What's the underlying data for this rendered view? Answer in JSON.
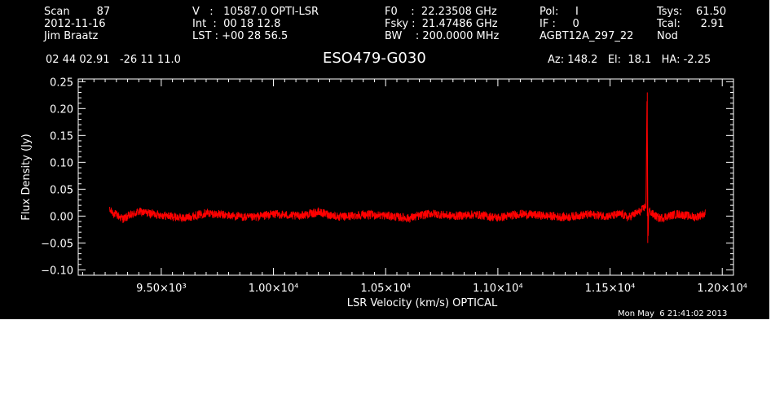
{
  "header": {
    "col1": [
      "Scan        87",
      "2012-11-16",
      "Jim Braatz"
    ],
    "col2": [
      "V   :   10587.0 OPTI-LSR",
      "Int  :  00 18 12.8",
      "LST : +00 28 56.5"
    ],
    "col3": [
      "F0    :  22.23508 GHz",
      "Fsky :  21.47486 GHz",
      "BW    : 200.0000 MHz"
    ],
    "col4": [
      "Pol:     I",
      "IF :     0",
      "AGBT12A_297_22"
    ],
    "col5": [
      "Tsys:    61.50",
      "Tcal:      2.91",
      "Nod"
    ]
  },
  "coords": "02 44 02.91   -26 11 11.0",
  "source": "ESO479-G030",
  "azelha": "Az: 148.2   El:  18.1   HA: -2.25",
  "timestamp": "Mon May  6 21:41:02 2013",
  "colors": {
    "background": "#000000",
    "axes": "#ffffff",
    "trace": "#ff0000"
  },
  "chart_data": {
    "type": "line",
    "title": "ESO479-G030",
    "xlabel": "LSR Velocity (km/s) OPTICAL",
    "ylabel": "Flux Density (Jy)",
    "xlim": [
      9130,
      12050
    ],
    "ylim": [
      -0.11,
      0.255
    ],
    "xticks": [
      9500,
      10000,
      10500,
      11000,
      11500,
      12000
    ],
    "xtick_labels": [
      "9.50×10³",
      "1.00×10⁴",
      "1.05×10⁴",
      "1.10×10⁴",
      "1.15×10⁴",
      "1.20×10⁴"
    ],
    "yticks": [
      -0.1,
      -0.05,
      0.0,
      0.05,
      0.1,
      0.15,
      0.2,
      0.25
    ],
    "ytick_labels": [
      "−0.10",
      "−0.05",
      "0.00",
      "0.05",
      "0.10",
      "0.15",
      "0.20",
      "0.25"
    ],
    "series": [
      {
        "x": [
          9270,
          9330,
          9400,
          9500,
          9600,
          9700,
          9800,
          9900,
          10000,
          10100,
          10200,
          10300,
          10400,
          10500,
          10600,
          10700,
          10800,
          10900,
          11000,
          11100,
          11200,
          11300,
          11400,
          11500,
          11550,
          11580,
          11600,
          11640,
          11660,
          11665,
          11667,
          11669,
          11672,
          11675,
          11690,
          11720,
          11800,
          11880,
          11925
        ],
        "y": [
          0.01,
          -0.005,
          0.008,
          0.002,
          -0.004,
          0.006,
          0.001,
          -0.003,
          0.004,
          0.0,
          0.007,
          -0.002,
          0.003,
          0.001,
          -0.004,
          0.005,
          0.0,
          0.003,
          -0.003,
          0.004,
          0.001,
          -0.002,
          0.003,
          0.0,
          0.004,
          -0.003,
          0.002,
          0.01,
          0.02,
          0.23,
          0.1,
          -0.05,
          0.005,
          0.01,
          0.003,
          -0.004,
          0.004,
          -0.002,
          0.005
        ],
        "noise": 0.008
      }
    ],
    "grid": false
  }
}
